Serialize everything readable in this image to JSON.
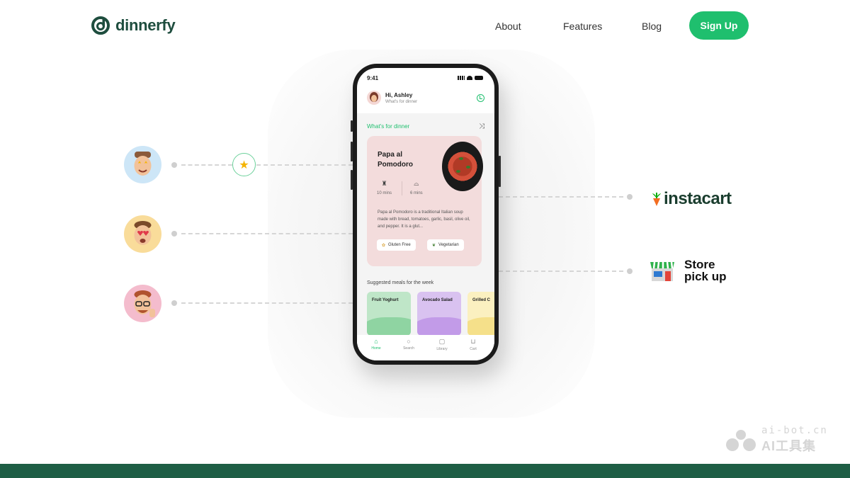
{
  "header": {
    "brand": "dinnerfy",
    "nav": [
      {
        "label": "About"
      },
      {
        "label": "Features"
      },
      {
        "label": "Blog"
      }
    ],
    "signup_label": "Sign Up"
  },
  "phone": {
    "time": "9:41",
    "greeting_name": "Hi, Ashley",
    "greeting_sub": "What's for dinner",
    "section_title": "What's for dinner",
    "recipe": {
      "title": "Papa al Pomodoro",
      "time_label": "10 mins",
      "servings_label": "6 mins",
      "description": "Papa al Pomodoro is a traditional Italian soup made with bread, tomatoes, garlic, basil, olive oil, and pepper. It is a glut...",
      "tags": [
        "Gluten Free",
        "Vegetarian"
      ]
    },
    "suggested_title": "Suggested meals for the week",
    "meals": [
      {
        "label": "Fruit Yoghurt",
        "bg": "#bfe6c8",
        "wave": "#8fd4a2"
      },
      {
        "label": "Avocado Salad",
        "bg": "#d9c2f0",
        "wave": "#c29be8"
      },
      {
        "label": "Grilled C",
        "bg": "#fbf0c0",
        "wave": "#f5e08a"
      }
    ],
    "tabs": [
      {
        "label": "Home",
        "icon": "home-icon"
      },
      {
        "label": "Search",
        "icon": "search-icon"
      },
      {
        "label": "Library",
        "icon": "library-icon"
      },
      {
        "label": "Cart",
        "icon": "cart-icon"
      }
    ]
  },
  "partners": {
    "instacart_label": "instacart",
    "store_line1": "Store",
    "store_line2": "pick up"
  },
  "watermark": {
    "line1": "ai-bot.cn",
    "line2": "AI工具集"
  },
  "colors": {
    "brand_green": "#1fbf6e",
    "dark_green": "#1e5e45",
    "logo_green": "#1e4d3e"
  }
}
